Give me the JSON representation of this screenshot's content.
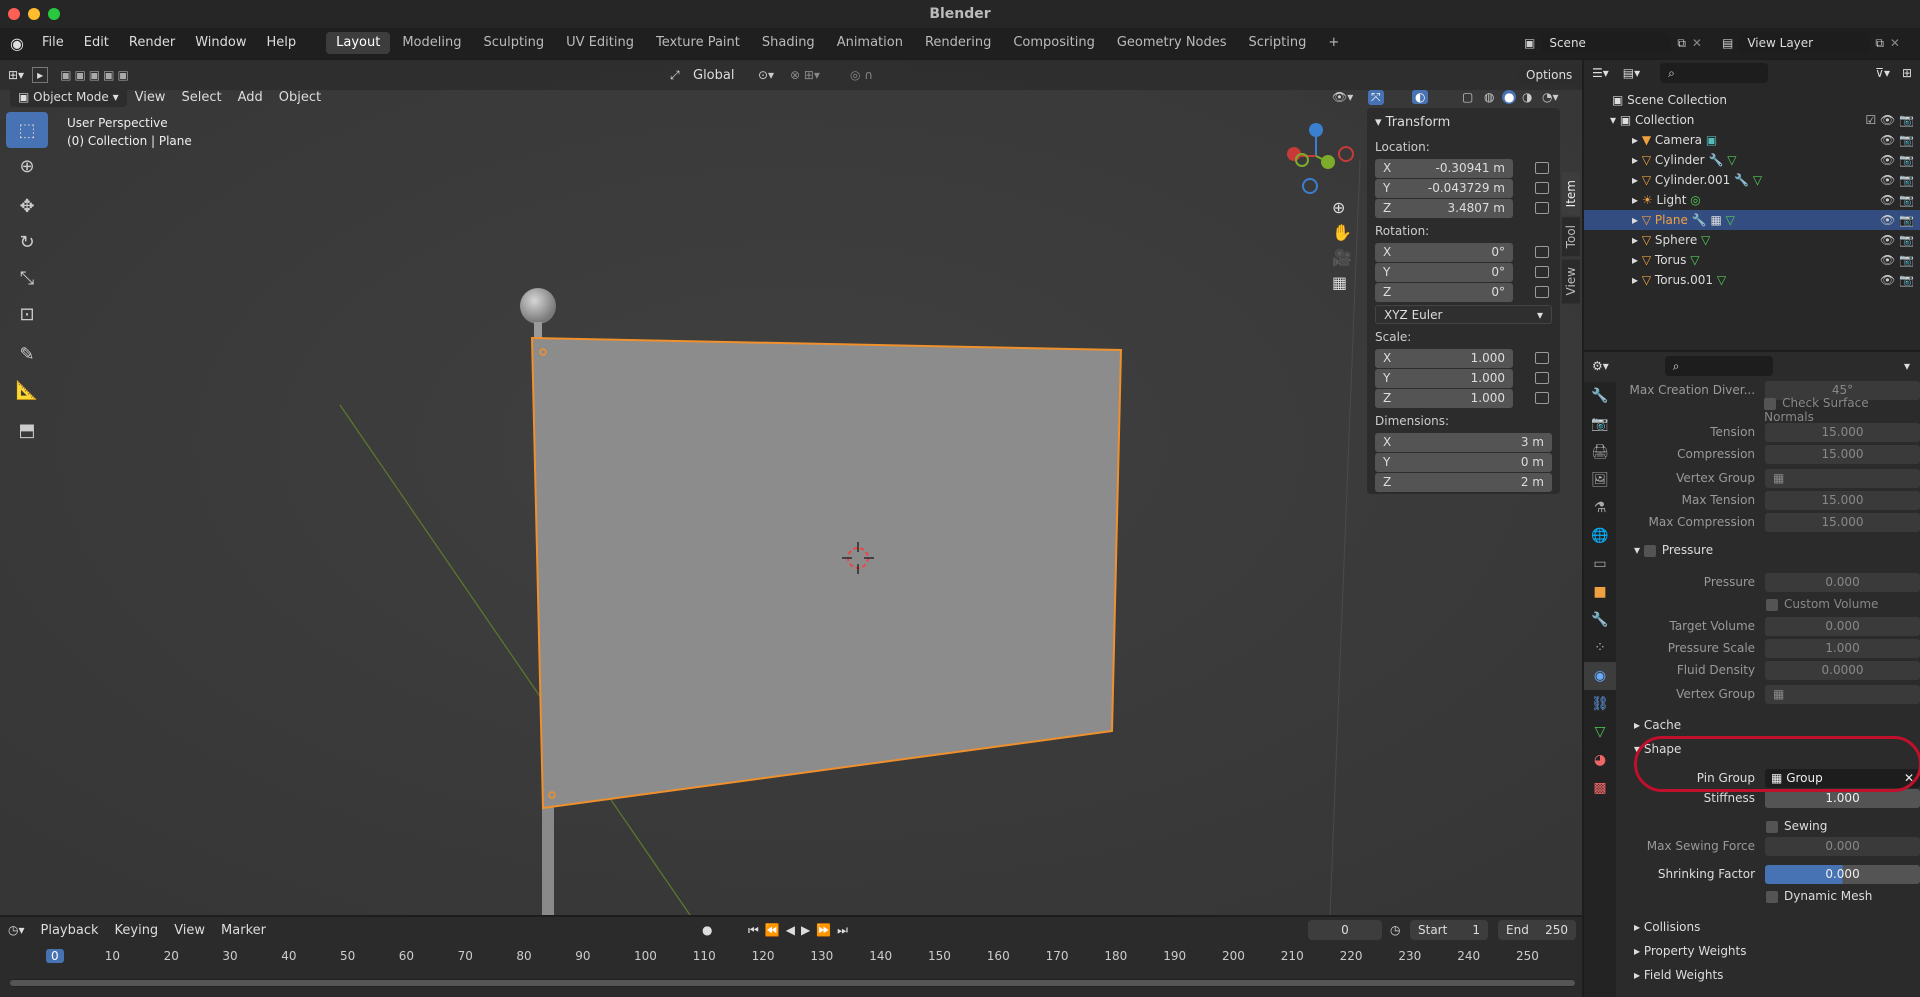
{
  "window": {
    "title": "Blender"
  },
  "colors": {
    "accent": "#4772b3",
    "selection": "#f0902c",
    "highlight_oval": "#c0102c"
  },
  "menu": [
    "File",
    "Edit",
    "Render",
    "Window",
    "Help"
  ],
  "workspaces": [
    "Layout",
    "Modeling",
    "Sculpting",
    "UV Editing",
    "Texture Paint",
    "Shading",
    "Animation",
    "Rendering",
    "Compositing",
    "Geometry Nodes",
    "Scripting"
  ],
  "scene": {
    "name": "Scene",
    "view_layer": "View Layer"
  },
  "viewport": {
    "mode": "Object Mode",
    "menus": [
      "View",
      "Select",
      "Add",
      "Object"
    ],
    "orientation": "Global",
    "options": "Options",
    "overlay_title": "User Perspective",
    "overlay_subtitle": "(0) Collection | Plane"
  },
  "n_panel": {
    "header": "Transform",
    "location_label": "Location:",
    "location": [
      {
        "axis": "X",
        "value": "-0.30941 m"
      },
      {
        "axis": "Y",
        "value": "-0.043729 m"
      },
      {
        "axis": "Z",
        "value": "3.4807 m"
      }
    ],
    "rotation_label": "Rotation:",
    "rotation": [
      {
        "axis": "X",
        "value": "0°"
      },
      {
        "axis": "Y",
        "value": "0°"
      },
      {
        "axis": "Z",
        "value": "0°"
      }
    ],
    "rotation_mode": "XYZ Euler",
    "scale_label": "Scale:",
    "scale": [
      {
        "axis": "X",
        "value": "1.000"
      },
      {
        "axis": "Y",
        "value": "1.000"
      },
      {
        "axis": "Z",
        "value": "1.000"
      }
    ],
    "dimensions_label": "Dimensions:",
    "dimensions": [
      {
        "axis": "X",
        "value": "3 m"
      },
      {
        "axis": "Y",
        "value": "0 m"
      },
      {
        "axis": "Z",
        "value": "2 m"
      }
    ],
    "tabs": [
      "Item",
      "Tool",
      "View"
    ]
  },
  "outliner": {
    "root": "Scene Collection",
    "collection": "Collection",
    "items": [
      "Camera",
      "Cylinder",
      "Cylinder.001",
      "Light",
      "Plane",
      "Sphere",
      "Torus",
      "Torus.001"
    ],
    "selected": "Plane"
  },
  "properties": {
    "max_creation": {
      "label": "Max Creation Diver...",
      "value": "45°"
    },
    "check_surface_normals": "Check Surface Normals",
    "tension": {
      "label": "Tension",
      "value": "15.000"
    },
    "compression": {
      "label": "Compression",
      "value": "15.000"
    },
    "vertex_group": "Vertex Group",
    "max_tension": {
      "label": "Max Tension",
      "value": "15.000"
    },
    "max_compression": {
      "label": "Max Compression",
      "value": "15.000"
    },
    "pressure_section": "Pressure",
    "pressure": {
      "label": "Pressure",
      "value": "0.000"
    },
    "custom_volume": "Custom Volume",
    "target_volume": {
      "label": "Target Volume",
      "value": "0.000"
    },
    "pressure_scale": {
      "label": "Pressure Scale",
      "value": "1.000"
    },
    "fluid_density": {
      "label": "Fluid Density",
      "value": "0.0000"
    },
    "vertex_group2": "Vertex Group",
    "cache": "Cache",
    "shape": "Shape",
    "pin_group": {
      "label": "Pin Group",
      "value": "Group"
    },
    "stiffness": {
      "label": "Stiffness",
      "value": "1.000"
    },
    "sewing": "Sewing",
    "max_sewing": {
      "label": "Max Sewing Force",
      "value": "0.000"
    },
    "shrinking": {
      "label": "Shrinking Factor",
      "value": "0.000"
    },
    "dynamic_mesh": "Dynamic Mesh",
    "collisions": "Collisions",
    "property_weights": "Property Weights",
    "field_weights": "Field Weights"
  },
  "timeline": {
    "menus": [
      "Playback",
      "Keying",
      "View",
      "Marker"
    ],
    "current_frame": "0",
    "start_label": "Start",
    "start": "1",
    "end_label": "End",
    "end": "250",
    "ticks": [
      "0",
      "10",
      "20",
      "30",
      "40",
      "50",
      "60",
      "70",
      "80",
      "90",
      "100",
      "110",
      "120",
      "130",
      "140",
      "150",
      "160",
      "170",
      "180",
      "190",
      "200",
      "210",
      "220",
      "230",
      "240",
      "250"
    ]
  }
}
